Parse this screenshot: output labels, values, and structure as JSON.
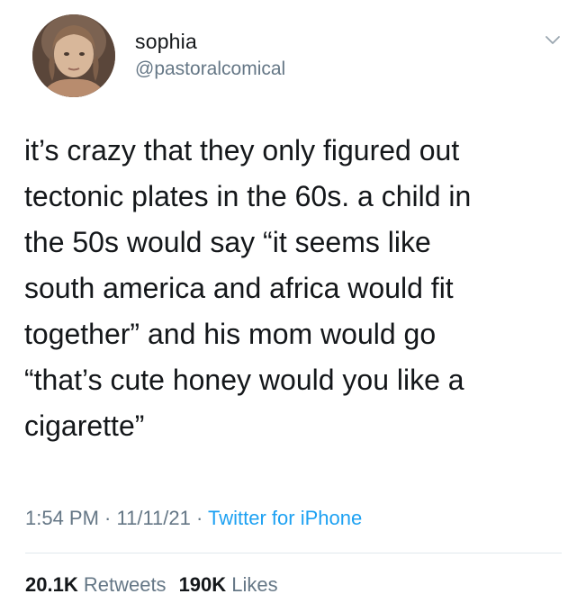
{
  "user": {
    "display_name": "sophia",
    "handle": "@pastoralcomical"
  },
  "tweet": {
    "lines": [
      "it’s crazy that they only figured out",
      "tectonic plates in the 60s. a child in",
      "the 50s would say “it seems like",
      "south america and africa would fit",
      "together” and his mom would go",
      "“that’s cute honey would you like a",
      "cigarette”"
    ]
  },
  "meta": {
    "time": "1:54 PM",
    "date": "11/11/21",
    "separator": " · ",
    "source": "Twitter for iPhone"
  },
  "stats": {
    "retweets_count": "20.1K",
    "retweets_label": "Retweets",
    "likes_count": "190K",
    "likes_label": "Likes"
  },
  "icons": {
    "menu": "chevron-down-icon"
  },
  "colors": {
    "secondary_text": "#657786",
    "link": "#1da1f2",
    "primary_text": "#14171a",
    "divider": "#e1e8ed"
  }
}
